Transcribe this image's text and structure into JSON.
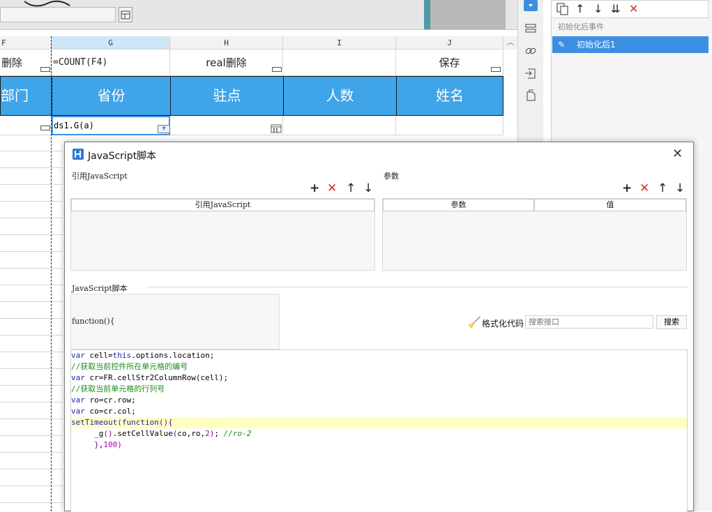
{
  "sheet": {
    "columns": [
      {
        "letter": "F"
      },
      {
        "letter": "G"
      },
      {
        "letter": "H"
      },
      {
        "letter": "I"
      },
      {
        "letter": "J"
      }
    ],
    "row1": [
      "删除",
      "=COUNT(F4)",
      "real删除",
      "",
      "保存"
    ],
    "row2": [
      "部门",
      "省份",
      "驻点",
      "人数",
      "姓名"
    ],
    "row3_g": "ds1.G(a)"
  },
  "right_panel": {
    "event_section_label": "初始化后事件",
    "event_item": "初始化后1"
  },
  "dialog": {
    "title": "JavaScript脚本",
    "ref_js_label": "引用JavaScript",
    "ref_js_column": "引用JavaScript",
    "params_label": "参数",
    "params_columns": [
      "参数",
      "值"
    ],
    "script_label": "JavaScript脚本",
    "function_sig": "function(){",
    "format_label": "格式化代码",
    "search_placeholder": "搜索接口",
    "search_button": "搜索",
    "code_lines": [
      "var cell=this.options.location;",
      "//获取当前控件所在单元格的编号",
      "var cr=FR.cellStr2ColumnRow(cell);",
      "//获取当前单元格的行列号",
      "var ro=cr.row;",
      "var co=cr.col;",
      "setTimeout(function(){",
      "     _g().setCellValue(co,ro,2); //ro-2",
      "     },100)"
    ]
  },
  "colors": {
    "header_blue": "#3fa4e8",
    "selected_event": "#3c8fe0",
    "highlight_line": "#ffffc2",
    "delete_red": "#e02b2b"
  }
}
